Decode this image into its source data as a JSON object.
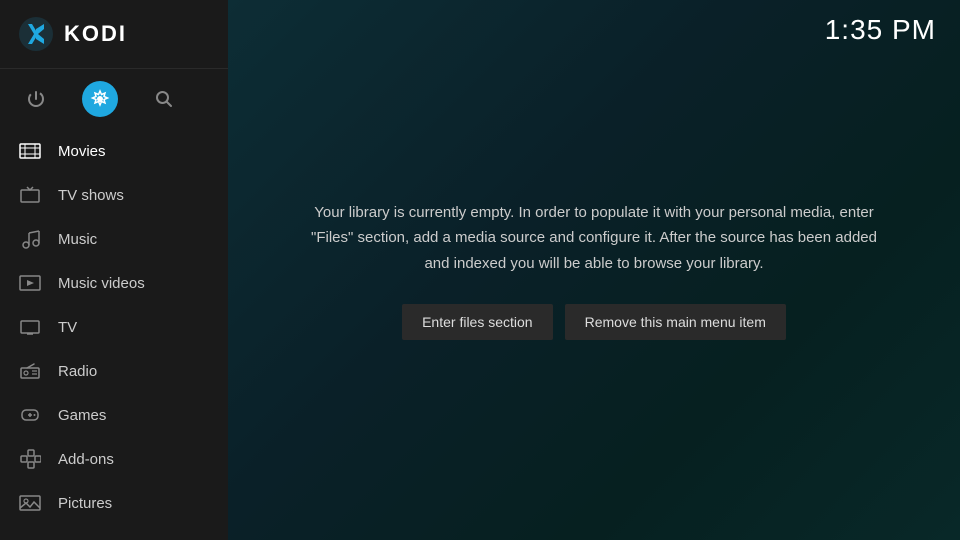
{
  "app": {
    "name": "KODI",
    "clock": "1:35 PM"
  },
  "sidebar": {
    "icons": [
      {
        "name": "power-icon",
        "symbol": "⏻",
        "active": false,
        "label": "Power"
      },
      {
        "name": "settings-icon",
        "symbol": "⚙",
        "active": true,
        "label": "Settings"
      },
      {
        "name": "search-icon",
        "symbol": "⌕",
        "active": false,
        "label": "Search"
      }
    ],
    "nav_items": [
      {
        "id": "movies",
        "label": "Movies",
        "icon": "movie-icon"
      },
      {
        "id": "tv-shows",
        "label": "TV shows",
        "icon": "tv-icon"
      },
      {
        "id": "music",
        "label": "Music",
        "icon": "music-icon"
      },
      {
        "id": "music-videos",
        "label": "Music videos",
        "icon": "music-video-icon"
      },
      {
        "id": "tv",
        "label": "TV",
        "icon": "tv-live-icon"
      },
      {
        "id": "radio",
        "label": "Radio",
        "icon": "radio-icon"
      },
      {
        "id": "games",
        "label": "Games",
        "icon": "games-icon"
      },
      {
        "id": "add-ons",
        "label": "Add-ons",
        "icon": "addons-icon"
      },
      {
        "id": "pictures",
        "label": "Pictures",
        "icon": "pictures-icon"
      }
    ]
  },
  "main": {
    "empty_library_message": "Your library is currently empty. In order to populate it with your personal media, enter \"Files\" section, add a media source and configure it. After the source has been added and indexed you will be able to browse your library.",
    "button_enter_files": "Enter files section",
    "button_remove_item": "Remove this main menu item"
  }
}
